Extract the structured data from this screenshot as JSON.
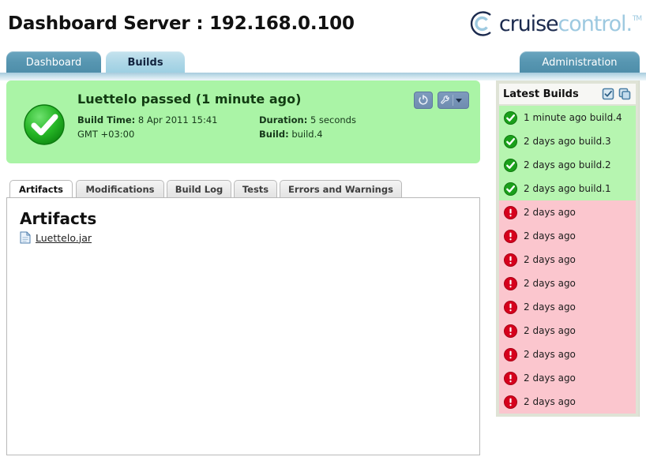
{
  "header": {
    "title": "Dashboard Server : 192.168.0.100",
    "logo": {
      "part1": "cruise",
      "part2": "control",
      "suffix": ".",
      "tm": "TM",
      "mark_icon": "cruisecontrol-c-logo-icon"
    }
  },
  "topnav": {
    "tabs": [
      {
        "label": "Dashboard",
        "active": false
      },
      {
        "label": "Builds",
        "active": true
      },
      {
        "label": "Administration",
        "active": false
      }
    ]
  },
  "status": {
    "icon": "green-check-circle-icon",
    "title": "Luettelo passed (1 minute ago)",
    "build_time_label": "Build Time:",
    "build_time_value": "8 Apr 2011 15:41",
    "build_time_value2": "GMT +03:00",
    "duration_label": "Duration:",
    "duration_value": "5 seconds",
    "build_label": "Build:",
    "build_value": "build.4",
    "actions": [
      {
        "name": "rebuild-button",
        "icon": "circular-arrow-icon"
      },
      {
        "name": "configure-button",
        "icon": "wrench-icon",
        "has_caret": true
      }
    ],
    "bg_color": "#aaf4a6"
  },
  "subtabs": [
    {
      "label": "Artifacts",
      "active": true
    },
    {
      "label": "Modifications",
      "active": false
    },
    {
      "label": "Build Log",
      "active": false
    },
    {
      "label": "Tests",
      "active": false
    },
    {
      "label": "Errors and Warnings",
      "active": false
    }
  ],
  "panel": {
    "title": "Artifacts",
    "artifacts": [
      {
        "name": "Luettelo.jar",
        "icon": "file-document-icon"
      }
    ]
  },
  "sidebar": {
    "title": "Latest Builds",
    "header_actions": [
      {
        "name": "checked-list-icon"
      },
      {
        "name": "copy-windows-icon"
      }
    ],
    "builds": [
      {
        "time": "1 minute ago",
        "build": "build.4",
        "status": "pass"
      },
      {
        "time": "2 days ago",
        "build": "build.3",
        "status": "pass"
      },
      {
        "time": "2 days ago",
        "build": "build.2",
        "status": "pass"
      },
      {
        "time": "2 days ago",
        "build": "build.1",
        "status": "pass"
      },
      {
        "time": "2 days ago",
        "build": "",
        "status": "fail"
      },
      {
        "time": "2 days ago",
        "build": "",
        "status": "fail"
      },
      {
        "time": "2 days ago",
        "build": "",
        "status": "fail"
      },
      {
        "time": "2 days ago",
        "build": "",
        "status": "fail"
      },
      {
        "time": "2 days ago",
        "build": "",
        "status": "fail"
      },
      {
        "time": "2 days ago",
        "build": "",
        "status": "fail"
      },
      {
        "time": "2 days ago",
        "build": "",
        "status": "fail"
      },
      {
        "time": "2 days ago",
        "build": "",
        "status": "fail"
      },
      {
        "time": "2 days ago",
        "build": "",
        "status": "fail"
      }
    ],
    "pass_color": "#b6f5b0",
    "fail_color": "#fbc6ce"
  }
}
